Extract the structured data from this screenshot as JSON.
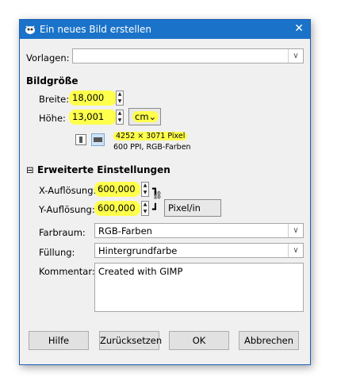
{
  "window": {
    "title": "Ein neues Bild erstellen"
  },
  "vorlagen": {
    "label": "Vorlagen:",
    "value": ""
  },
  "bildgroesse": {
    "heading": "Bildgröße",
    "breite_label": "Breite:",
    "breite_value": "18,000",
    "hoehe_label": "Höhe:",
    "hoehe_value": "13,001",
    "unit": "cm",
    "pixel_info": "4252 × 3071 Pixel",
    "ppi_info": "600 PPI, RGB-Farben"
  },
  "erweitert": {
    "heading": "Erweiterte Einstellungen",
    "xres_label": "X-Auflösung:",
    "xres_value": "600,000",
    "yres_label": "Y-Auflösung:",
    "yres_value": "600,000",
    "res_unit": "Pixel/in",
    "farbraum_label": "Farbraum:",
    "farbraum_value": "RGB-Farben",
    "fuellung_label": "Füllung:",
    "fuellung_value": "Hintergrundfarbe",
    "kommentar_label": "Kommentar:",
    "kommentar_value": "Created with GIMP"
  },
  "buttons": {
    "hilfe": "Hilfe",
    "zuruecksetzen": "Zurücksetzen",
    "ok": "OK",
    "abbrechen": "Abbrechen"
  },
  "colors": {
    "titlebar": "#1a73c9",
    "highlight": "#ffff4d"
  }
}
